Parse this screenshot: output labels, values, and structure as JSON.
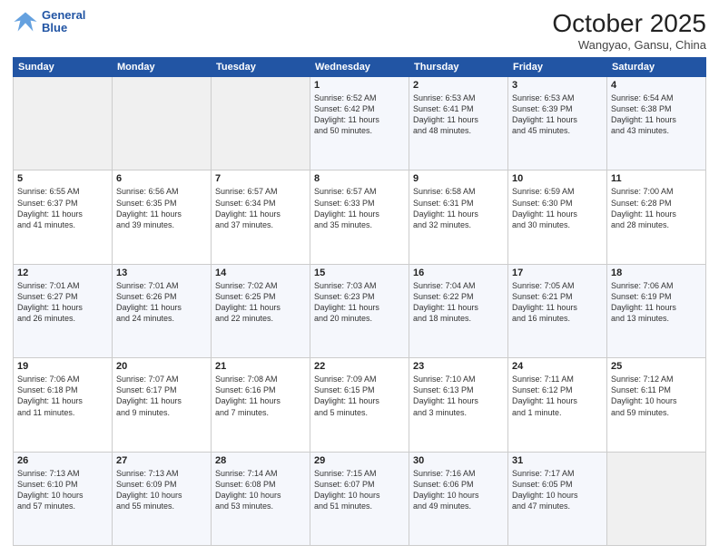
{
  "header": {
    "logo_line1": "General",
    "logo_line2": "Blue",
    "month_year": "October 2025",
    "location": "Wangyao, Gansu, China"
  },
  "weekdays": [
    "Sunday",
    "Monday",
    "Tuesday",
    "Wednesday",
    "Thursday",
    "Friday",
    "Saturday"
  ],
  "weeks": [
    [
      {
        "day": "",
        "info": ""
      },
      {
        "day": "",
        "info": ""
      },
      {
        "day": "",
        "info": ""
      },
      {
        "day": "1",
        "info": "Sunrise: 6:52 AM\nSunset: 6:42 PM\nDaylight: 11 hours\nand 50 minutes."
      },
      {
        "day": "2",
        "info": "Sunrise: 6:53 AM\nSunset: 6:41 PM\nDaylight: 11 hours\nand 48 minutes."
      },
      {
        "day": "3",
        "info": "Sunrise: 6:53 AM\nSunset: 6:39 PM\nDaylight: 11 hours\nand 45 minutes."
      },
      {
        "day": "4",
        "info": "Sunrise: 6:54 AM\nSunset: 6:38 PM\nDaylight: 11 hours\nand 43 minutes."
      }
    ],
    [
      {
        "day": "5",
        "info": "Sunrise: 6:55 AM\nSunset: 6:37 PM\nDaylight: 11 hours\nand 41 minutes."
      },
      {
        "day": "6",
        "info": "Sunrise: 6:56 AM\nSunset: 6:35 PM\nDaylight: 11 hours\nand 39 minutes."
      },
      {
        "day": "7",
        "info": "Sunrise: 6:57 AM\nSunset: 6:34 PM\nDaylight: 11 hours\nand 37 minutes."
      },
      {
        "day": "8",
        "info": "Sunrise: 6:57 AM\nSunset: 6:33 PM\nDaylight: 11 hours\nand 35 minutes."
      },
      {
        "day": "9",
        "info": "Sunrise: 6:58 AM\nSunset: 6:31 PM\nDaylight: 11 hours\nand 32 minutes."
      },
      {
        "day": "10",
        "info": "Sunrise: 6:59 AM\nSunset: 6:30 PM\nDaylight: 11 hours\nand 30 minutes."
      },
      {
        "day": "11",
        "info": "Sunrise: 7:00 AM\nSunset: 6:28 PM\nDaylight: 11 hours\nand 28 minutes."
      }
    ],
    [
      {
        "day": "12",
        "info": "Sunrise: 7:01 AM\nSunset: 6:27 PM\nDaylight: 11 hours\nand 26 minutes."
      },
      {
        "day": "13",
        "info": "Sunrise: 7:01 AM\nSunset: 6:26 PM\nDaylight: 11 hours\nand 24 minutes."
      },
      {
        "day": "14",
        "info": "Sunrise: 7:02 AM\nSunset: 6:25 PM\nDaylight: 11 hours\nand 22 minutes."
      },
      {
        "day": "15",
        "info": "Sunrise: 7:03 AM\nSunset: 6:23 PM\nDaylight: 11 hours\nand 20 minutes."
      },
      {
        "day": "16",
        "info": "Sunrise: 7:04 AM\nSunset: 6:22 PM\nDaylight: 11 hours\nand 18 minutes."
      },
      {
        "day": "17",
        "info": "Sunrise: 7:05 AM\nSunset: 6:21 PM\nDaylight: 11 hours\nand 16 minutes."
      },
      {
        "day": "18",
        "info": "Sunrise: 7:06 AM\nSunset: 6:19 PM\nDaylight: 11 hours\nand 13 minutes."
      }
    ],
    [
      {
        "day": "19",
        "info": "Sunrise: 7:06 AM\nSunset: 6:18 PM\nDaylight: 11 hours\nand 11 minutes."
      },
      {
        "day": "20",
        "info": "Sunrise: 7:07 AM\nSunset: 6:17 PM\nDaylight: 11 hours\nand 9 minutes."
      },
      {
        "day": "21",
        "info": "Sunrise: 7:08 AM\nSunset: 6:16 PM\nDaylight: 11 hours\nand 7 minutes."
      },
      {
        "day": "22",
        "info": "Sunrise: 7:09 AM\nSunset: 6:15 PM\nDaylight: 11 hours\nand 5 minutes."
      },
      {
        "day": "23",
        "info": "Sunrise: 7:10 AM\nSunset: 6:13 PM\nDaylight: 11 hours\nand 3 minutes."
      },
      {
        "day": "24",
        "info": "Sunrise: 7:11 AM\nSunset: 6:12 PM\nDaylight: 11 hours\nand 1 minute."
      },
      {
        "day": "25",
        "info": "Sunrise: 7:12 AM\nSunset: 6:11 PM\nDaylight: 10 hours\nand 59 minutes."
      }
    ],
    [
      {
        "day": "26",
        "info": "Sunrise: 7:13 AM\nSunset: 6:10 PM\nDaylight: 10 hours\nand 57 minutes."
      },
      {
        "day": "27",
        "info": "Sunrise: 7:13 AM\nSunset: 6:09 PM\nDaylight: 10 hours\nand 55 minutes."
      },
      {
        "day": "28",
        "info": "Sunrise: 7:14 AM\nSunset: 6:08 PM\nDaylight: 10 hours\nand 53 minutes."
      },
      {
        "day": "29",
        "info": "Sunrise: 7:15 AM\nSunset: 6:07 PM\nDaylight: 10 hours\nand 51 minutes."
      },
      {
        "day": "30",
        "info": "Sunrise: 7:16 AM\nSunset: 6:06 PM\nDaylight: 10 hours\nand 49 minutes."
      },
      {
        "day": "31",
        "info": "Sunrise: 7:17 AM\nSunset: 6:05 PM\nDaylight: 10 hours\nand 47 minutes."
      },
      {
        "day": "",
        "info": ""
      }
    ]
  ]
}
